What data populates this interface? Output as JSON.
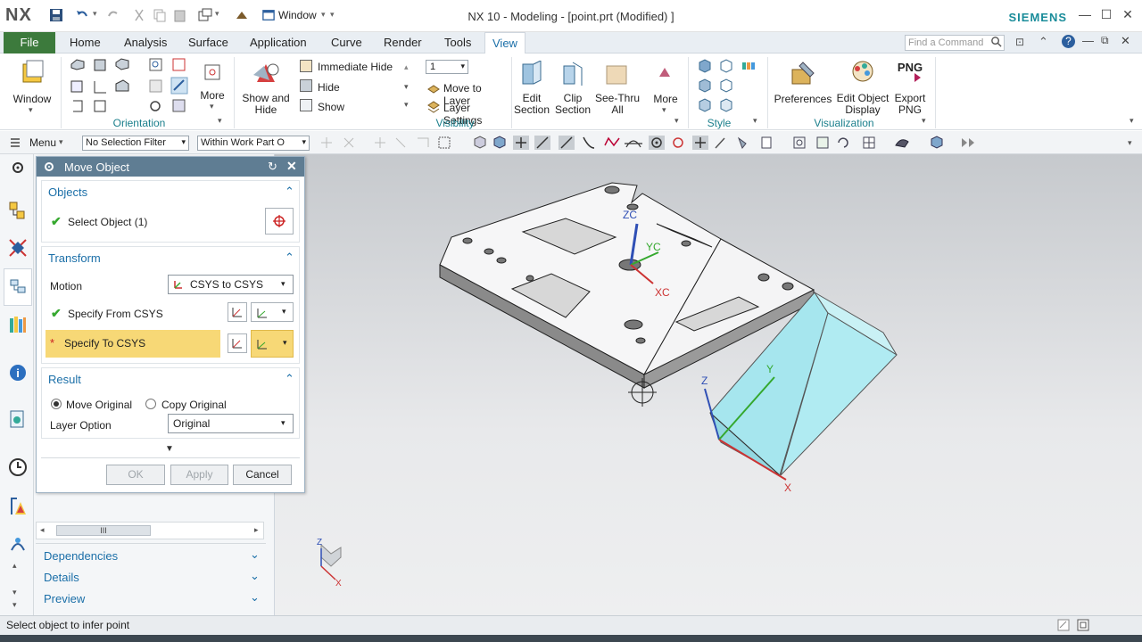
{
  "titlebar": {
    "logo": "NX",
    "window_menu": "Window",
    "title": "NX 10 - Modeling - [point.prt (Modified) ]",
    "brand": "SIEMENS"
  },
  "tabs": [
    {
      "label": "File"
    },
    {
      "label": "Home"
    },
    {
      "label": "Analysis"
    },
    {
      "label": "Surface"
    },
    {
      "label": "Application"
    },
    {
      "label": "Curve"
    },
    {
      "label": "Render"
    },
    {
      "label": "Tools"
    },
    {
      "label": "View"
    }
  ],
  "command_finder_placeholder": "Find a Command",
  "ribbon": {
    "window_label": "Window",
    "orientation_label": "Orientation",
    "more_label": "More",
    "show_hide_label": "Show and Hide",
    "immediate_hide": "Immediate Hide",
    "hide": "Hide",
    "show": "Show",
    "layer_value": "1",
    "move_to_layer": "Move to Layer",
    "layer_settings": "Layer Settings",
    "visibility_label": "Visibility",
    "edit_section": "Edit Section",
    "clip_section": "Clip Section",
    "see_thru_all": "See-Thru All",
    "more2_label": "More",
    "style_label": "Style",
    "preferences": "Preferences",
    "edit_object_display": "Edit Object Display",
    "export_png_icon": "PNG",
    "export_png": "Export PNG",
    "visualization_label": "Visualization"
  },
  "toolbar": {
    "menu_label": "Menu",
    "selection_filter": "No Selection Filter",
    "scope": "Within Work Part O"
  },
  "dialog": {
    "title": "Move Object",
    "objects": {
      "header": "Objects",
      "select_object": "Select Object (1)"
    },
    "transform": {
      "header": "Transform",
      "motion_label": "Motion",
      "motion_value": "CSYS to CSYS",
      "specify_from": "Specify From CSYS",
      "specify_to": "Specify To CSYS"
    },
    "result": {
      "header": "Result",
      "move_original": "Move Original",
      "copy_original": "Copy Original",
      "selected": "Move Original",
      "layer_option_label": "Layer Option",
      "layer_option_value": "Original"
    },
    "buttons": {
      "ok": "OK",
      "apply": "Apply",
      "cancel": "Cancel"
    }
  },
  "navigator": {
    "scrollbar_grip": "III",
    "dependencies": "Dependencies",
    "details": "Details",
    "preview": "Preview"
  },
  "viewport": {
    "zc": "ZC",
    "yc": "YC",
    "xc": "XC",
    "z": "Z",
    "y": "Y",
    "x": "X",
    "triad_z": "Z",
    "triad_x": "X"
  },
  "status": {
    "message": "Select object to infer point"
  },
  "colors": {
    "accent": "#1b6fa8",
    "dialog_title": "#5f7d93",
    "required_field": "#f7d876",
    "check_green": "#35a82e",
    "brand": "#1a8c9a",
    "block_cyan": "#a6e6ee"
  }
}
